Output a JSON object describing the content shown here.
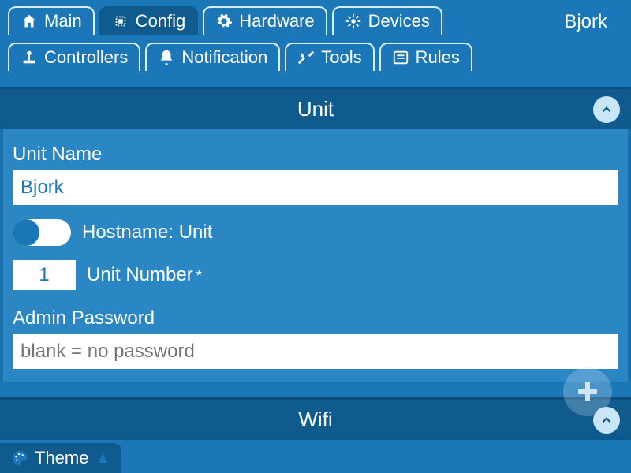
{
  "device_name": "Bjork",
  "tabs": {
    "main": "Main",
    "config": "Config",
    "hardware": "Hardware",
    "devices": "Devices",
    "controllers": "Controllers",
    "notification": "Notification",
    "tools": "Tools",
    "rules": "Rules"
  },
  "unit": {
    "section_title": "Unit",
    "name_label": "Unit Name",
    "name_value": "Bjork",
    "hostname_label": "Hostname: Unit",
    "number_label": "Unit Number",
    "number_value": "1",
    "password_label": "Admin Password",
    "password_placeholder": "blank = no password"
  },
  "wifi": {
    "section_title": "Wifi"
  },
  "theme": {
    "label": "Theme"
  }
}
